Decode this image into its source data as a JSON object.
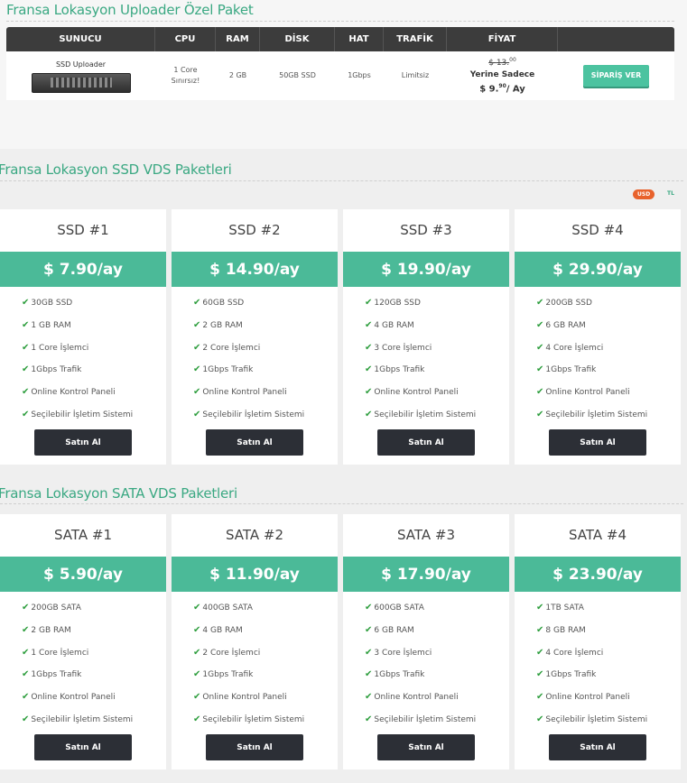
{
  "uploader": {
    "title": "Fransa Lokasyon Uploader Özel Paket",
    "headers": [
      "SUNUCU",
      "CPU",
      "RAM",
      "DİSK",
      "HAT",
      "TRAFİK",
      "FİYAT",
      ""
    ],
    "row": {
      "server_name": "SSD Uploader",
      "cpu_line1": "1 Core",
      "cpu_line2": "Sınırsız!",
      "ram": "2 GB",
      "disk": "50GB SSD",
      "hat": "1Gbps",
      "trafik": "Limitsiz",
      "old_price_prefix": "$ ",
      "old_price": "13.",
      "old_cents": "00",
      "instead_text": "Yerine Sadece",
      "new_price_prefix": "$ 9.",
      "new_cents": "90",
      "new_price_suffix": "/ Ay",
      "order_label": "SİPARİŞ VER"
    }
  },
  "currency": {
    "usd": "USD",
    "tl": "TL"
  },
  "ssd": {
    "title": "Fransa Lokasyon SSD VDS Paketleri",
    "cards": [
      {
        "name": "SSD #1",
        "price": "$ 7.90/ay",
        "features": [
          "30GB SSD",
          "1 GB RAM",
          "1 Core İşlemci",
          "1Gbps Trafik",
          "Online Kontrol Paneli",
          "Seçilebilir İşletim Sistemi"
        ],
        "button": "Satın Al"
      },
      {
        "name": "SSD #2",
        "price": "$ 14.90/ay",
        "features": [
          "60GB SSD",
          "2 GB RAM",
          "2 Core İşlemci",
          "1Gbps Trafik",
          "Online Kontrol Paneli",
          "Seçilebilir İşletim Sistemi"
        ],
        "button": "Satın Al"
      },
      {
        "name": "SSD #3",
        "price": "$ 19.90/ay",
        "features": [
          "120GB SSD",
          "4 GB RAM",
          "3 Core İşlemci",
          "1Gbps Trafik",
          "Online Kontrol Paneli",
          "Seçilebilir İşletim Sistemi"
        ],
        "button": "Satın Al"
      },
      {
        "name": "SSD #4",
        "price": "$ 29.90/ay",
        "features": [
          "200GB SSD",
          "6 GB RAM",
          "4 Core İşlemci",
          "1Gbps Trafik",
          "Online Kontrol Paneli",
          "Seçilebilir İşletim Sistemi"
        ],
        "button": "Satın Al"
      }
    ]
  },
  "sata": {
    "title": "Fransa Lokasyon SATA VDS Paketleri",
    "cards": [
      {
        "name": "SATA #1",
        "price": "$ 5.90/ay",
        "features": [
          "200GB SATA",
          "2 GB RAM",
          "1 Core İşlemci",
          "1Gbps Trafik",
          "Online Kontrol Paneli",
          "Seçilebilir İşletim Sistemi"
        ],
        "button": "Satın Al"
      },
      {
        "name": "SATA #2",
        "price": "$ 11.90/ay",
        "features": [
          "400GB SATA",
          "4 GB RAM",
          "2 Core İşlemci",
          "1Gbps Trafik",
          "Online Kontrol Paneli",
          "Seçilebilir İşletim Sistemi"
        ],
        "button": "Satın Al"
      },
      {
        "name": "SATA #3",
        "price": "$ 17.90/ay",
        "features": [
          "600GB SATA",
          "6 GB RAM",
          "3 Core İşlemci",
          "1Gbps Trafik",
          "Online Kontrol Paneli",
          "Seçilebilir İşletim Sistemi"
        ],
        "button": "Satın Al"
      },
      {
        "name": "SATA #4",
        "price": "$ 23.90/ay",
        "features": [
          "1TB SATA",
          "8 GB RAM",
          "4 Core İşlemci",
          "1Gbps Trafik",
          "Online Kontrol Paneli",
          "Seçilebilir İşletim Sistemi"
        ],
        "button": "Satın Al"
      }
    ]
  }
}
